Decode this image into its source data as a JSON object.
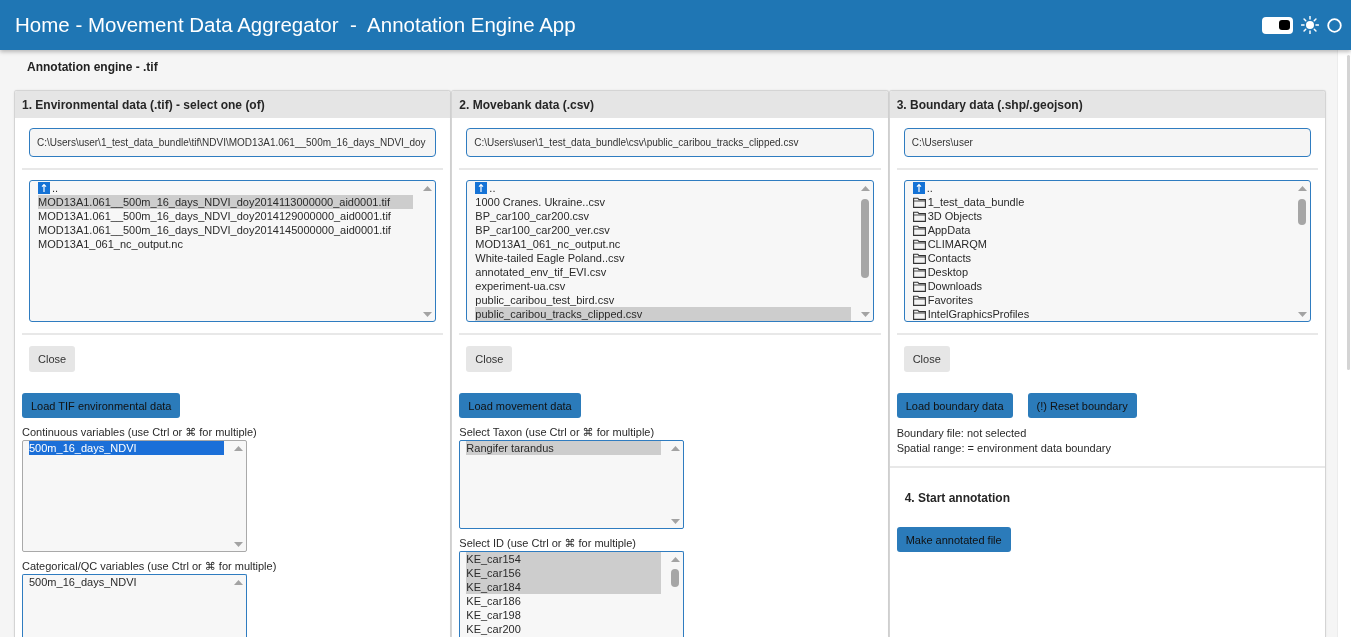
{
  "header": {
    "title": "Home - Movement Data Aggregator  -  Annotation Engine App",
    "theme_toggle": {
      "on": true
    }
  },
  "page_title": "Annotation engine - .tif",
  "panels": [
    {
      "title": "1. Environmental data (.tif) - select one (of)",
      "path": "C:\\Users\\user\\1_test_data_bundle\\tif\\NDVI\\MOD13A1.061__500m_16_days_NDVI_doy",
      "files": [
        {
          "name": "..",
          "kind": "parent",
          "selected": false
        },
        {
          "name": "MOD13A1.061__500m_16_days_NDVI_doy2014113000000_aid0001.tif",
          "kind": "file",
          "selected": true
        },
        {
          "name": "MOD13A1.061__500m_16_days_NDVI_doy2014129000000_aid0001.tif",
          "kind": "file",
          "selected": false
        },
        {
          "name": "MOD13A1.061__500m_16_days_NDVI_doy2014145000000_aid0001.tif",
          "kind": "file",
          "selected": false
        },
        {
          "name": "MOD13A1_061_nc_output.nc",
          "kind": "file",
          "selected": false
        }
      ],
      "close_button": "Close",
      "sections": [
        {
          "kind": "buttons",
          "buttons": [
            "Load TIF environmental data"
          ]
        },
        {
          "kind": "select",
          "label": "Continuous variables (use Ctrl or ⌘ for multiple)",
          "focused": true,
          "options": [
            {
              "label": "500m_16_days_NDVI",
              "selected": true
            }
          ]
        },
        {
          "kind": "select",
          "label": "Categorical/QC variables (use Ctrl or ⌘ for multiple)",
          "focused": false,
          "options": [
            {
              "label": "500m_16_days_NDVI",
              "selected": false
            }
          ]
        }
      ]
    },
    {
      "title": "2. Movebank data (.csv)",
      "path": "C:\\Users\\user\\1_test_data_bundle\\csv\\public_caribou_tracks_clipped.csv",
      "files": [
        {
          "name": "..",
          "kind": "parent",
          "selected": false
        },
        {
          "name": "1000 Cranes. Ukraine..csv",
          "kind": "file",
          "selected": false
        },
        {
          "name": "BP_car100_car200.csv",
          "kind": "file",
          "selected": false
        },
        {
          "name": "BP_car100_car200_ver.csv",
          "kind": "file",
          "selected": false
        },
        {
          "name": "MOD13A1_061_nc_output.nc",
          "kind": "file",
          "selected": false
        },
        {
          "name": "White-tailed Eagle Poland..csv",
          "kind": "file",
          "selected": false
        },
        {
          "name": "annotated_env_tif_EVI.csv",
          "kind": "file",
          "selected": false
        },
        {
          "name": "experiment-ua.csv",
          "kind": "file",
          "selected": false
        },
        {
          "name": "public_caribou_test_bird.csv",
          "kind": "file",
          "selected": false
        },
        {
          "name": "public_caribou_tracks_clipped.csv",
          "kind": "file",
          "selected": true
        }
      ],
      "close_button": "Close",
      "sections": [
        {
          "kind": "buttons",
          "buttons": [
            "Load movement data"
          ]
        },
        {
          "kind": "select",
          "label": "Select Taxon (use Ctrl or ⌘ for multiple)",
          "focused": false,
          "options": [
            {
              "label": "Rangifer tarandus",
              "selected": true
            }
          ]
        },
        {
          "kind": "select",
          "label": "Select ID (use Ctrl or ⌘ for multiple)",
          "focused": false,
          "options": [
            {
              "label": "KE_car154",
              "selected": true
            },
            {
              "label": "KE_car156",
              "selected": true
            },
            {
              "label": "KE_car184",
              "selected": true
            },
            {
              "label": "KE_car186",
              "selected": false
            },
            {
              "label": "KE_car198",
              "selected": false
            },
            {
              "label": "KE_car200",
              "selected": false
            }
          ]
        }
      ]
    },
    {
      "title": "3. Boundary data (.shp/.geojson)",
      "path": "C:\\Users\\user",
      "files": [
        {
          "name": "..",
          "kind": "parent",
          "selected": false
        },
        {
          "name": "1_test_data_bundle",
          "kind": "folder",
          "selected": false
        },
        {
          "name": "3D Objects",
          "kind": "folder",
          "selected": false
        },
        {
          "name": "AppData",
          "kind": "folder",
          "selected": false
        },
        {
          "name": "CLIMARQM",
          "kind": "folder",
          "selected": false
        },
        {
          "name": "Contacts",
          "kind": "folder",
          "selected": false
        },
        {
          "name": "Desktop",
          "kind": "folder",
          "selected": false
        },
        {
          "name": "Downloads",
          "kind": "folder",
          "selected": false
        },
        {
          "name": "Favorites",
          "kind": "folder",
          "selected": false
        },
        {
          "name": "IntelGraphicsProfiles",
          "kind": "folder",
          "selected": false
        }
      ],
      "close_button": "Close",
      "sections": [
        {
          "kind": "buttons",
          "buttons": [
            "Load boundary data",
            "(!) Reset boundary"
          ]
        },
        {
          "kind": "notes",
          "lines": [
            "Boundary file: not selected",
            "Spatial range: = environment data boundary"
          ]
        },
        {
          "kind": "heading",
          "text": "4. Start annotation"
        },
        {
          "kind": "buttons",
          "buttons": [
            "Make annotated file"
          ]
        }
      ]
    }
  ]
}
